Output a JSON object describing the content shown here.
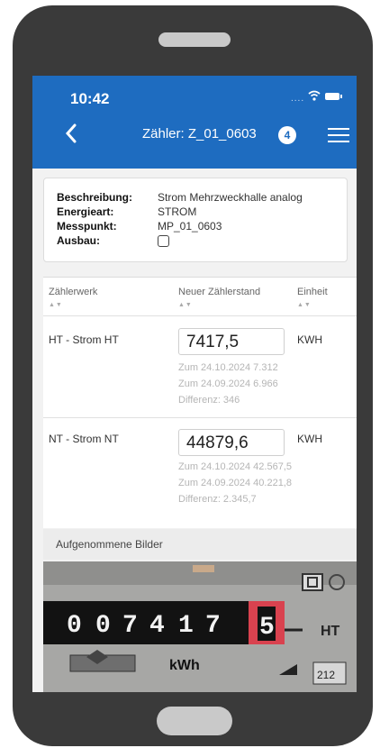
{
  "status_bar": {
    "time": "10:42",
    "signal": "...."
  },
  "app_bar": {
    "title": "Zähler: Z_01_0603",
    "badge_count": "4"
  },
  "info_card": {
    "description_label": "Beschreibung:",
    "description_value": "Strom Mehrzweckhalle analog",
    "energy_label": "Energieart:",
    "energy_value": "STROM",
    "measure_label": "Messpunkt:",
    "measure_value": "MP_01_0603",
    "removal_label": "Ausbau:",
    "removal_checked": false
  },
  "table": {
    "headers": [
      "Zählerwerk",
      "Neuer Zählerstand",
      "Einheit"
    ],
    "sort_glyph": "▲▼",
    "rows": [
      {
        "name": "HT - Strom HT",
        "new_reading": "7417,5",
        "unit": "KWH",
        "history": [
          "Zum 24.10.2024  7.312",
          "Zum 24.09.2024  6.966",
          "Differenz: 346"
        ]
      },
      {
        "name": "NT - Strom NT",
        "new_reading": "44879,6",
        "unit": "KWH",
        "history": [
          "Zum 24.10.2024  42.567,5",
          "Zum 24.09.2024  40.221,8",
          "Differenz: 2.345,7"
        ]
      }
    ]
  },
  "images_section": {
    "title": "Aufgenommene Bilder"
  },
  "meter_photo": {
    "digits": [
      "0",
      "0",
      "7",
      "4",
      "1",
      "7",
      "5"
    ],
    "right_label": "HT",
    "unit_label": "kWh",
    "counter_value": "212"
  },
  "colors": {
    "primary": "#1e6cc0",
    "phone_frame": "#3a3a3a",
    "meter_red": "#d9424f"
  }
}
